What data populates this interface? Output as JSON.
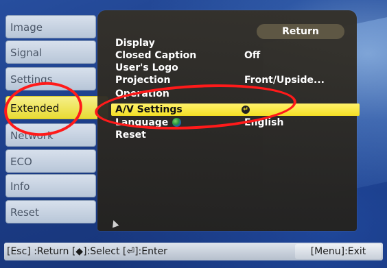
{
  "sidebar": {
    "tabs": [
      {
        "label": "Image",
        "active": false
      },
      {
        "label": "Signal",
        "active": false
      },
      {
        "label": "Settings",
        "active": false
      },
      {
        "label": "Extended",
        "active": true
      },
      {
        "label": "Network",
        "active": false
      },
      {
        "label": "ECO",
        "active": false
      },
      {
        "label": "Info",
        "active": false
      },
      {
        "label": "Reset",
        "active": false
      }
    ]
  },
  "menu": {
    "return_label": "Return",
    "items": [
      {
        "label": "Display",
        "value": ""
      },
      {
        "label": "Closed Caption",
        "value": "Off"
      },
      {
        "label": "User's Logo",
        "value": ""
      },
      {
        "label": "Projection",
        "value": "Front/Upside..."
      },
      {
        "label": "Operation",
        "value": ""
      },
      {
        "label": "A/V Settings",
        "value": "",
        "selected": true
      },
      {
        "label": "Language",
        "value": "English"
      },
      {
        "label": "Reset",
        "value": ""
      }
    ]
  },
  "help_bar": {
    "text": "[Esc] :Return  [◆]:Select  [⏎]:Enter",
    "exit_label": "[Menu]:Exit"
  },
  "colors": {
    "highlight": "#f4df24",
    "panel": "#2e2b25",
    "annotation": "#ff1a1a",
    "background": "#1d3f8a"
  },
  "icons": {
    "enter": "enter-icon",
    "language": "globe-icon",
    "pointer": "cursor-icon"
  }
}
